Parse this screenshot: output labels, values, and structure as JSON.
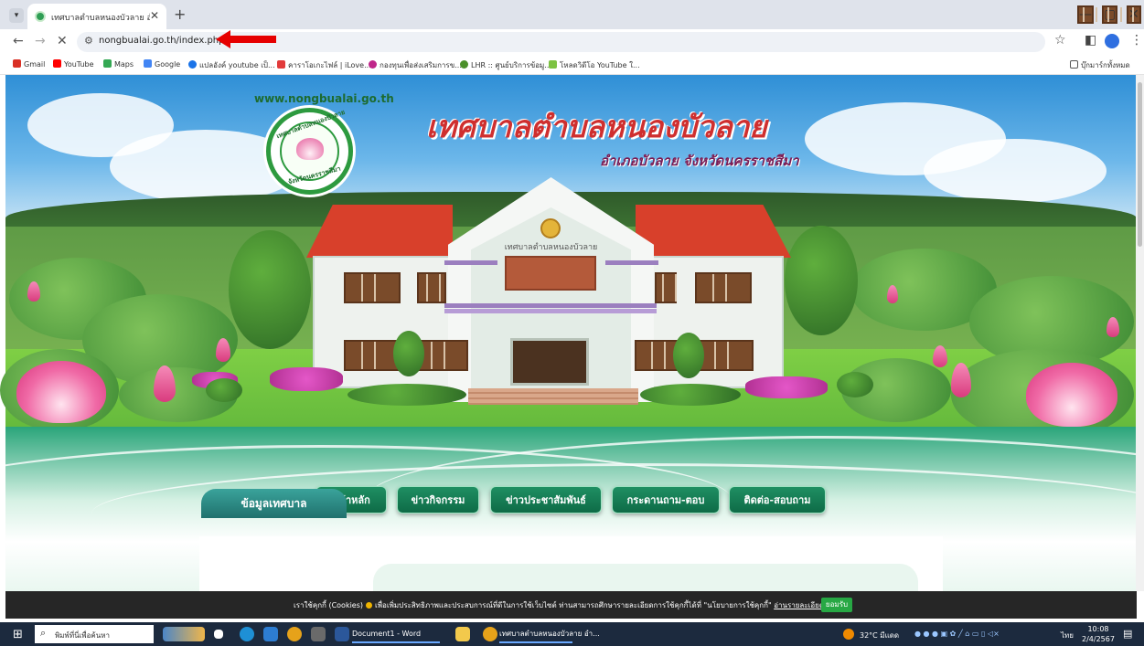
{
  "browser": {
    "tab_title": "เทศบาลตำบลหนองบัวลาย อำเภอบัวลาย จ.",
    "tab_close": "✕",
    "new_tab": "+",
    "url": "nongbualai.go.th/index.php",
    "window_controls": [
      "—",
      "▢",
      "✕"
    ],
    "bookmarks": [
      {
        "label": "Gmail",
        "color": "#d93025"
      },
      {
        "label": "YouTube",
        "color": "#ff0000"
      },
      {
        "label": "Maps",
        "color": "#34a853"
      },
      {
        "label": "Google",
        "color": "#4285f4"
      },
      {
        "label": "แปลอังค์ youtube เป็...",
        "color": "#1a73e8"
      },
      {
        "label": "คาราโอเกะไฟล์ | iLove...",
        "color": "#e23b3b"
      },
      {
        "label": "กองทุนเพื่อส่งเสริมการข...",
        "color": "#c0268a"
      },
      {
        "label": "LHR :: ศูนย์บริการข้อมู...",
        "color": "#4a8f2a"
      },
      {
        "label": "โหลดวิดีโอ YouTube ใ...",
        "color": "#7cc242"
      }
    ],
    "bookmarks_folder": "บุ๊กมาร์กทั้งหมด"
  },
  "site": {
    "url_text": "www.nongbualai.go.th",
    "logo_top": "เทศบาลตำบลหนองบัวลาย",
    "logo_bottom": "จังหวัดนครราชสีมา",
    "title": "เทศบาลตำบลหนองบัวลาย",
    "subtitle": "อำเภอบัวลาย จังหวัดนครราชสีมา",
    "building_sign": "เทศบาลตำบลหนองบัวลาย",
    "menu": [
      "หน้าหลัก",
      "ข่าวกิจกรรม",
      "ข่าวประชาสัมพันธ์",
      "กระดานถาม-ตอบ",
      "ติดต่อ-สอบถาม"
    ],
    "info_tab": "ข้อมูลเทศบาล"
  },
  "cookie_bar": {
    "lead": "เราใช้คุกกี้ (Cookies)",
    "text": "เพื่อเพิ่มประสิทธิภาพและประสบการณ์ที่ดีในการใช้เว็บไซต์ ท่านสามารถศึกษารายละเอียดการใช้คุกกี้ได้ที่ \"นโยบายการใช้คุกกี้\"",
    "link": "อ่านรายละเอียดเพิ่มเติม",
    "accept": "ยอมรับ"
  },
  "taskbar": {
    "search_placeholder": "พิมพ์ที่นี่เพื่อค้นหา",
    "word_app": "Document1 - Word",
    "browser_app": "เทศบาลตำบลหนองบัวลาย อำ...",
    "weather": "32°C มีแดด",
    "lang": "ไทย",
    "time": "10:08",
    "date": "2/4/2567"
  }
}
